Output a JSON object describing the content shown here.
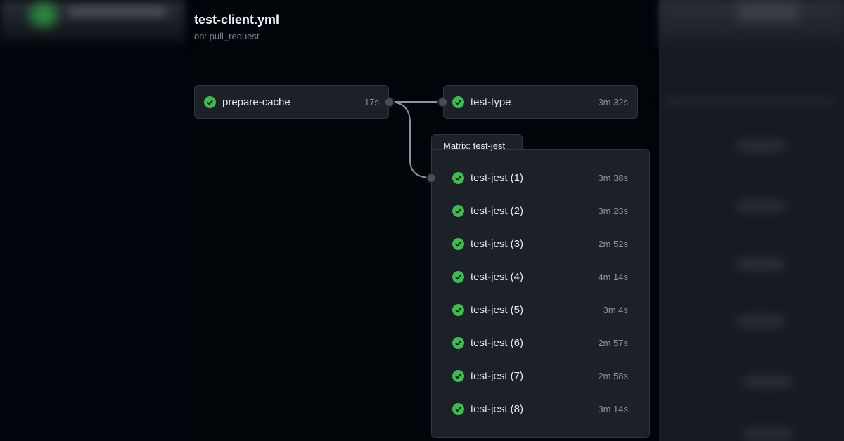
{
  "workflow": {
    "title": "test-client.yml",
    "trigger": "on: pull_request"
  },
  "jobs": [
    {
      "name": "prepare-cache",
      "duration": "17s",
      "status": "success"
    },
    {
      "name": "test-type",
      "duration": "3m 32s",
      "status": "success"
    }
  ],
  "matrix": {
    "label": "Matrix: test-jest",
    "jobs": [
      {
        "name": "test-jest (1)",
        "duration": "3m 38s",
        "status": "success"
      },
      {
        "name": "test-jest (2)",
        "duration": "3m 23s",
        "status": "success"
      },
      {
        "name": "test-jest (3)",
        "duration": "2m 52s",
        "status": "success"
      },
      {
        "name": "test-jest (4)",
        "duration": "4m 14s",
        "status": "success"
      },
      {
        "name": "test-jest (5)",
        "duration": "3m 4s",
        "status": "success"
      },
      {
        "name": "test-jest (6)",
        "duration": "2m 57s",
        "status": "success"
      },
      {
        "name": "test-jest (7)",
        "duration": "2m 58s",
        "status": "success"
      },
      {
        "name": "test-jest (8)",
        "duration": "3m 14s",
        "status": "success"
      }
    ]
  },
  "colors": {
    "success": "#3fb950",
    "background": "#010409",
    "card": "#1c2128",
    "border": "#30363d"
  },
  "icons": {
    "status": "check-circle-icon"
  }
}
